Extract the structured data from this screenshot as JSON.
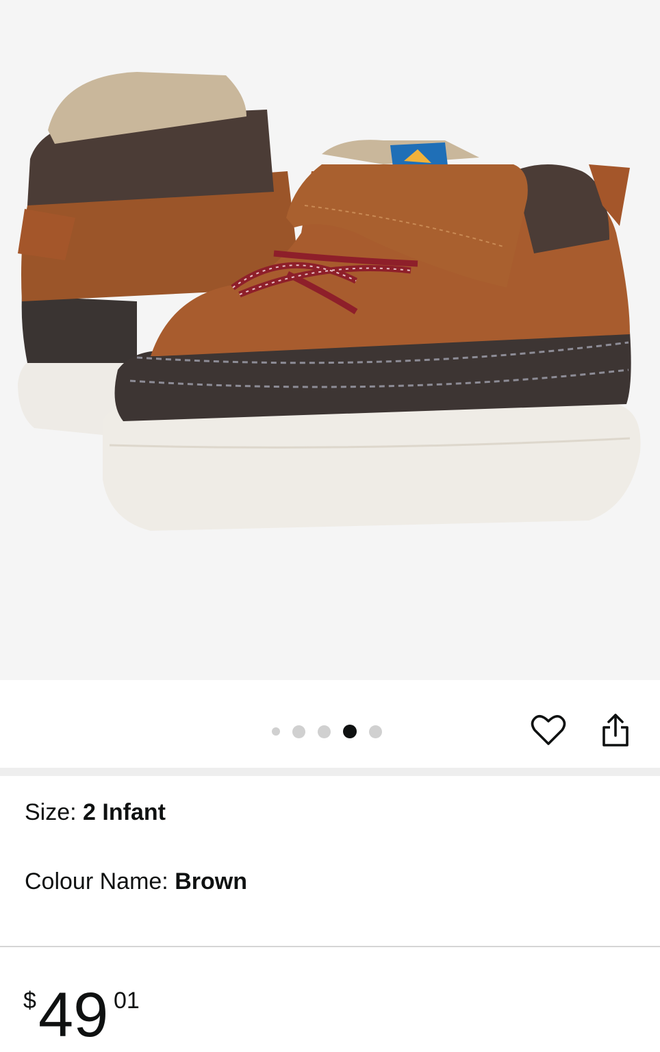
{
  "product": {
    "image_alt": "Brown leather toddler boot with white sole",
    "carousel": {
      "count": 5,
      "active_index": 3
    }
  },
  "actions": {
    "wishlist_icon": "heart-icon",
    "share_icon": "share-icon"
  },
  "options": {
    "size_label": "Size: ",
    "size_value": "2 Infant",
    "colour_label": "Colour Name: ",
    "colour_value": "Brown"
  },
  "price": {
    "currency": "$",
    "whole": "49",
    "fraction": "01"
  },
  "colors": {
    "background": "#f5f5f5",
    "text": "#0f1111",
    "dot_inactive": "#d0d0d0",
    "dot_active": "#0f1111"
  }
}
